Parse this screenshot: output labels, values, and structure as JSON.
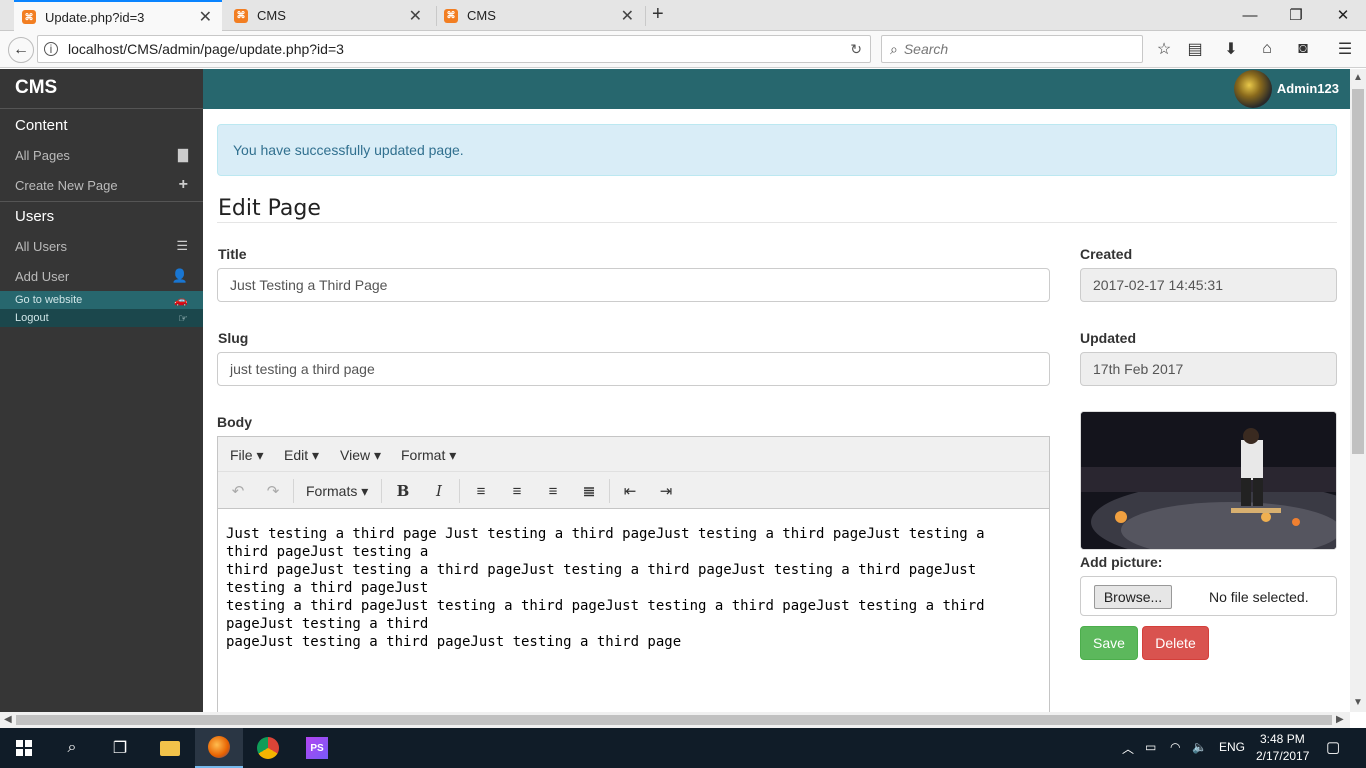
{
  "browser": {
    "tabs": [
      {
        "label": "Update.php?id=3",
        "active": true
      },
      {
        "label": "CMS",
        "active": false
      },
      {
        "label": "CMS",
        "active": false
      }
    ],
    "url": "localhost/CMS/admin/page/update.php?id=3",
    "search_placeholder": "Search"
  },
  "sidebar": {
    "brand": "CMS",
    "content_header": "Content",
    "content_items": [
      {
        "label": "All Pages",
        "icon": "file-icon"
      },
      {
        "label": "Create New Page",
        "icon": "plus-icon"
      }
    ],
    "users_header": "Users",
    "users_items": [
      {
        "label": "All Users",
        "icon": "list-icon"
      },
      {
        "label": "Add User",
        "icon": "user-add-icon"
      }
    ],
    "links": [
      {
        "label": "Go to website",
        "icon": "car-icon"
      },
      {
        "label": "Logout",
        "icon": "logout-icon"
      }
    ]
  },
  "header": {
    "username": "Admin123"
  },
  "alert": {
    "message": "You have successfully updated page."
  },
  "page": {
    "heading": "Edit Page",
    "title_label": "Title",
    "title_value": "Just Testing a Third Page",
    "slug_label": "Slug",
    "slug_value": "just testing a third page",
    "body_label": "Body",
    "created_label": "Created",
    "created_value": "2017-02-17 14:45:31",
    "updated_label": "Updated",
    "updated_value": "17th Feb 2017",
    "add_picture_label": "Add picture:",
    "browse_label": "Browse...",
    "no_file_label": "No file selected.",
    "save_label": "Save",
    "delete_label": "Delete"
  },
  "editor": {
    "menus": [
      "File",
      "Edit",
      "View",
      "Format"
    ],
    "formats_label": "Formats",
    "body_lines": [
      "Just testing a third page Just testing a third pageJust testing a third pageJust testing a third pageJust testing a",
      "third pageJust testing a third pageJust testing a third pageJust testing a third pageJust testing a third pageJust",
      "testing a third pageJust testing a third pageJust testing a third pageJust testing a third pageJust testing a third",
      "pageJust testing a third pageJust testing a third page"
    ]
  },
  "taskbar": {
    "language": "ENG",
    "time": "3:48 PM",
    "date": "2/17/2017"
  },
  "colors": {
    "header_bg": "#27676e",
    "sidebar_bg": "#363636",
    "save_green": "#5cb85c",
    "delete_red": "#d9534f",
    "alert_bg": "#d9edf7"
  }
}
